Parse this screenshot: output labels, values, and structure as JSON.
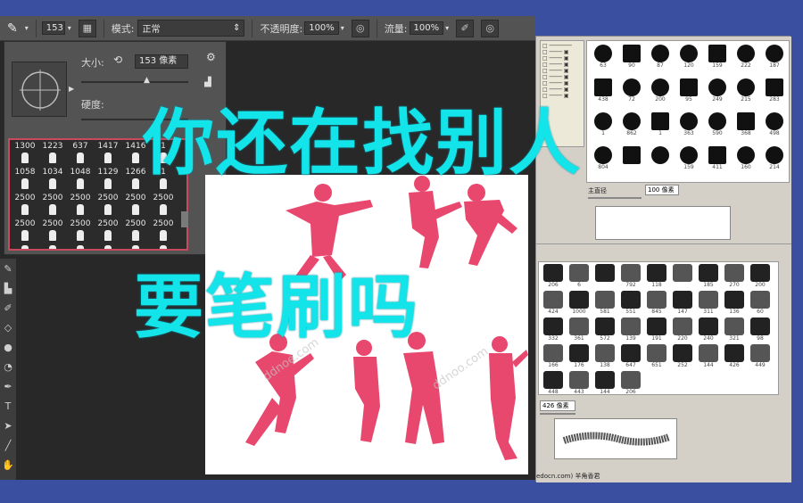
{
  "optionsbar": {
    "size_badge": "153",
    "mode_label": "模式:",
    "mode_value": "正常",
    "opacity_label": "不透明度:",
    "opacity_value": "100%",
    "flow_label": "流量:",
    "flow_value": "100%"
  },
  "brush_panel": {
    "size_label": "大小:",
    "size_value": "153 像素",
    "hardness_label": "硬度:",
    "presets": [
      [
        "1300",
        "1223",
        "637",
        "1417",
        "1416",
        "1"
      ],
      [
        "1058",
        "1034",
        "1048",
        "1129",
        "1266",
        "1"
      ],
      [
        "2500",
        "2500",
        "2500",
        "2500",
        "2500",
        "2500"
      ],
      [
        "2500",
        "2500",
        "2500",
        "2500",
        "2500",
        "2500"
      ]
    ]
  },
  "right_window": {
    "top_numbers": [
      "63",
      "90",
      "87",
      "120",
      "159",
      "222",
      "187",
      "438",
      "72",
      "200",
      "95",
      "249",
      "215",
      "283",
      "1",
      "862",
      "1",
      "363",
      "590",
      "368",
      "498",
      "804",
      "",
      "",
      "159",
      "411",
      "160",
      "214"
    ],
    "size_label": "主直径",
    "size_value": "100 像素",
    "bottom_numbers": [
      "206",
      "6",
      "",
      "792",
      "118",
      "",
      "185",
      "270",
      "200",
      "424",
      "1000",
      "581",
      "551",
      "845",
      "147",
      "311",
      "136",
      "60",
      "332",
      "361",
      "572",
      "139",
      "191",
      "220",
      "240",
      "321",
      "98",
      "166",
      "176",
      "138",
      "647",
      "651",
      "252",
      "144",
      "426",
      "449",
      "448",
      "443",
      "144",
      "206"
    ],
    "size2_value": "426 像素",
    "footer": "edocn.com)    羊角香君"
  },
  "overlay": {
    "line1": "你还在找别人",
    "line2": "要笔刷吗"
  },
  "colors": {
    "overlay_text": "#12e4ea",
    "silhouette": "#e8486e",
    "background": "#3a4fa0"
  }
}
